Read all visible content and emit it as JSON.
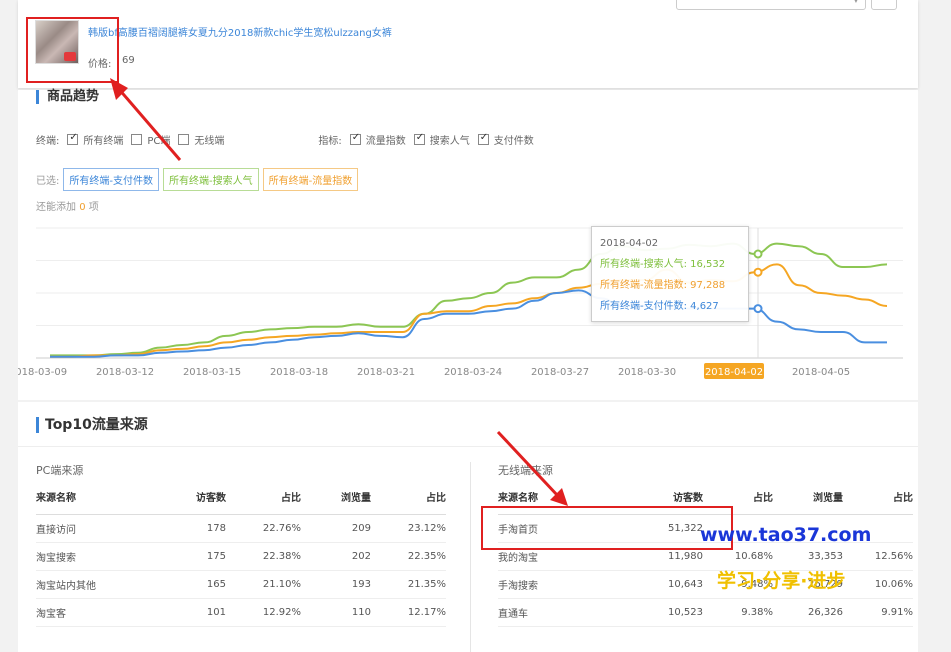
{
  "product": {
    "title": "韩版bf高腰百褶阔腿裤女夏九分2018新款chic学生宽松ulzzang女裤",
    "price_label": "价格:",
    "price_value": "69"
  },
  "trend": {
    "heading": "商品趋势",
    "filter": {
      "terminal_label": "终端:",
      "terminals": [
        {
          "label": "所有终端",
          "checked": true
        },
        {
          "label": "PC端",
          "checked": false
        },
        {
          "label": "无线端",
          "checked": false
        }
      ],
      "metric_label": "指标:",
      "metrics": [
        {
          "label": "流量指数",
          "checked": true
        },
        {
          "label": "搜索人气",
          "checked": true
        },
        {
          "label": "支付件数",
          "checked": true
        }
      ]
    },
    "selected_label": "已选:",
    "selected_tags": [
      {
        "label": "所有终端-支付件数",
        "color": "#3c86d8"
      },
      {
        "label": "所有终端-搜索人气",
        "color": "#7ebf3c"
      },
      {
        "label": "所有终端-流量指数",
        "color": "#f0a030"
      }
    ],
    "add_more_prefix": "还能添加",
    "add_more_count": "0",
    "add_more_suffix": "项",
    "tooltip": {
      "date": "2018-04-02",
      "line1": "所有终端-搜索人气: 16,532",
      "line2": "所有终端-流量指数: 97,288",
      "line3": "所有终端-支付件数: 4,627"
    }
  },
  "chart_data": {
    "type": "line",
    "x_ticks": [
      "2018-03-09",
      "2018-03-12",
      "2018-03-15",
      "2018-03-18",
      "2018-03-21",
      "2018-03-24",
      "2018-03-27",
      "2018-03-30",
      "2018-04-02",
      "2018-04-05"
    ],
    "highlight_tick": "2018-04-02",
    "ylim": [
      0,
      100
    ],
    "grid": true,
    "series": [
      {
        "name": "所有终端-搜索人气",
        "color": "#8cc653",
        "values": [
          2,
          2,
          2,
          3,
          4,
          8,
          10,
          12,
          17,
          20,
          22,
          23,
          24,
          24,
          26,
          24,
          24,
          34,
          44,
          46,
          50,
          58,
          62,
          62,
          68,
          80,
          86,
          83,
          84,
          87,
          86,
          88,
          80,
          88,
          86,
          80,
          70,
          70,
          72
        ]
      },
      {
        "name": "所有终端-流量指数",
        "color": "#f5a623",
        "values": [
          1,
          1,
          2,
          2,
          3,
          6,
          7,
          9,
          12,
          14,
          16,
          17,
          18,
          19,
          20,
          20,
          20,
          34,
          36,
          36,
          40,
          42,
          46,
          50,
          54,
          57,
          60,
          60,
          68,
          58,
          60,
          59,
          66,
          72,
          56,
          50,
          48,
          45,
          40
        ]
      },
      {
        "name": "所有终端-支付件数",
        "color": "#4a8fe0",
        "values": [
          1,
          1,
          1,
          2,
          2,
          4,
          5,
          6,
          8,
          10,
          12,
          14,
          16,
          17,
          19,
          17,
          16,
          30,
          34,
          34,
          36,
          38,
          44,
          50,
          52,
          46,
          40,
          40,
          38,
          38,
          38,
          38,
          38,
          28,
          22,
          20,
          20,
          12,
          12
        ]
      }
    ]
  },
  "top10": {
    "heading": "Top10流量来源",
    "pc": {
      "title": "PC端来源",
      "headers": [
        "来源名称",
        "访客数",
        "占比",
        "浏览量",
        "占比"
      ],
      "rows": [
        [
          "直接访问",
          "178",
          "22.76%",
          "209",
          "23.12%"
        ],
        [
          "淘宝搜索",
          "175",
          "22.38%",
          "202",
          "22.35%"
        ],
        [
          "淘宝站内其他",
          "165",
          "21.10%",
          "193",
          "21.35%"
        ],
        [
          "淘宝客",
          "101",
          "12.92%",
          "110",
          "12.17%"
        ]
      ]
    },
    "mobile": {
      "title": "无线端来源",
      "headers": [
        "来源名称",
        "访客数",
        "占比",
        "浏览量",
        "占比"
      ],
      "rows": [
        [
          "手淘首页",
          "51,322",
          "",
          "",
          ""
        ],
        [
          "我的淘宝",
          "11,980",
          "10.68%",
          "33,353",
          "12.56%"
        ],
        [
          "手淘搜索",
          "10,643",
          "9.48%",
          "26,729",
          "10.06%"
        ],
        [
          "直通车",
          "10,523",
          "9.38%",
          "26,326",
          "9.91%"
        ]
      ]
    }
  },
  "watermark": {
    "url": "www.tao37.com",
    "slogan": "学习·分享·进步"
  }
}
